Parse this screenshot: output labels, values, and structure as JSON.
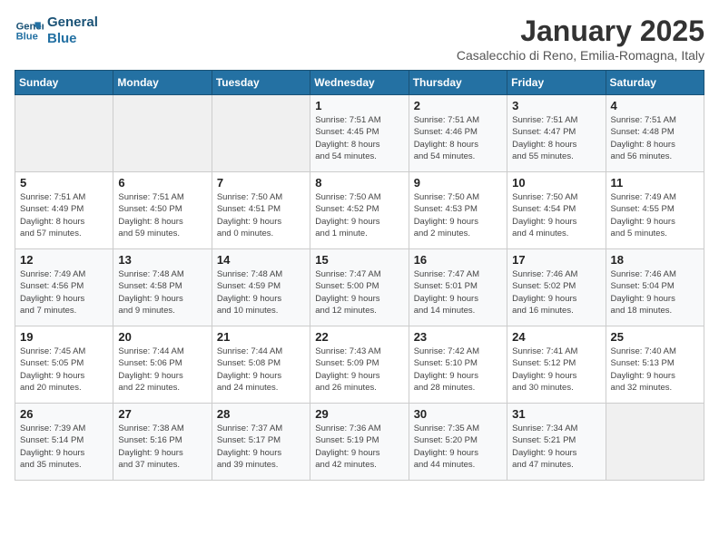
{
  "logo": {
    "line1": "General",
    "line2": "Blue"
  },
  "title": "January 2025",
  "subtitle": "Casalecchio di Reno, Emilia-Romagna, Italy",
  "weekdays": [
    "Sunday",
    "Monday",
    "Tuesday",
    "Wednesday",
    "Thursday",
    "Friday",
    "Saturday"
  ],
  "weeks": [
    [
      {
        "day": "",
        "info": ""
      },
      {
        "day": "",
        "info": ""
      },
      {
        "day": "",
        "info": ""
      },
      {
        "day": "1",
        "info": "Sunrise: 7:51 AM\nSunset: 4:45 PM\nDaylight: 8 hours\nand 54 minutes."
      },
      {
        "day": "2",
        "info": "Sunrise: 7:51 AM\nSunset: 4:46 PM\nDaylight: 8 hours\nand 54 minutes."
      },
      {
        "day": "3",
        "info": "Sunrise: 7:51 AM\nSunset: 4:47 PM\nDaylight: 8 hours\nand 55 minutes."
      },
      {
        "day": "4",
        "info": "Sunrise: 7:51 AM\nSunset: 4:48 PM\nDaylight: 8 hours\nand 56 minutes."
      }
    ],
    [
      {
        "day": "5",
        "info": "Sunrise: 7:51 AM\nSunset: 4:49 PM\nDaylight: 8 hours\nand 57 minutes."
      },
      {
        "day": "6",
        "info": "Sunrise: 7:51 AM\nSunset: 4:50 PM\nDaylight: 8 hours\nand 59 minutes."
      },
      {
        "day": "7",
        "info": "Sunrise: 7:50 AM\nSunset: 4:51 PM\nDaylight: 9 hours\nand 0 minutes."
      },
      {
        "day": "8",
        "info": "Sunrise: 7:50 AM\nSunset: 4:52 PM\nDaylight: 9 hours\nand 1 minute."
      },
      {
        "day": "9",
        "info": "Sunrise: 7:50 AM\nSunset: 4:53 PM\nDaylight: 9 hours\nand 2 minutes."
      },
      {
        "day": "10",
        "info": "Sunrise: 7:50 AM\nSunset: 4:54 PM\nDaylight: 9 hours\nand 4 minutes."
      },
      {
        "day": "11",
        "info": "Sunrise: 7:49 AM\nSunset: 4:55 PM\nDaylight: 9 hours\nand 5 minutes."
      }
    ],
    [
      {
        "day": "12",
        "info": "Sunrise: 7:49 AM\nSunset: 4:56 PM\nDaylight: 9 hours\nand 7 minutes."
      },
      {
        "day": "13",
        "info": "Sunrise: 7:48 AM\nSunset: 4:58 PM\nDaylight: 9 hours\nand 9 minutes."
      },
      {
        "day": "14",
        "info": "Sunrise: 7:48 AM\nSunset: 4:59 PM\nDaylight: 9 hours\nand 10 minutes."
      },
      {
        "day": "15",
        "info": "Sunrise: 7:47 AM\nSunset: 5:00 PM\nDaylight: 9 hours\nand 12 minutes."
      },
      {
        "day": "16",
        "info": "Sunrise: 7:47 AM\nSunset: 5:01 PM\nDaylight: 9 hours\nand 14 minutes."
      },
      {
        "day": "17",
        "info": "Sunrise: 7:46 AM\nSunset: 5:02 PM\nDaylight: 9 hours\nand 16 minutes."
      },
      {
        "day": "18",
        "info": "Sunrise: 7:46 AM\nSunset: 5:04 PM\nDaylight: 9 hours\nand 18 minutes."
      }
    ],
    [
      {
        "day": "19",
        "info": "Sunrise: 7:45 AM\nSunset: 5:05 PM\nDaylight: 9 hours\nand 20 minutes."
      },
      {
        "day": "20",
        "info": "Sunrise: 7:44 AM\nSunset: 5:06 PM\nDaylight: 9 hours\nand 22 minutes."
      },
      {
        "day": "21",
        "info": "Sunrise: 7:44 AM\nSunset: 5:08 PM\nDaylight: 9 hours\nand 24 minutes."
      },
      {
        "day": "22",
        "info": "Sunrise: 7:43 AM\nSunset: 5:09 PM\nDaylight: 9 hours\nand 26 minutes."
      },
      {
        "day": "23",
        "info": "Sunrise: 7:42 AM\nSunset: 5:10 PM\nDaylight: 9 hours\nand 28 minutes."
      },
      {
        "day": "24",
        "info": "Sunrise: 7:41 AM\nSunset: 5:12 PM\nDaylight: 9 hours\nand 30 minutes."
      },
      {
        "day": "25",
        "info": "Sunrise: 7:40 AM\nSunset: 5:13 PM\nDaylight: 9 hours\nand 32 minutes."
      }
    ],
    [
      {
        "day": "26",
        "info": "Sunrise: 7:39 AM\nSunset: 5:14 PM\nDaylight: 9 hours\nand 35 minutes."
      },
      {
        "day": "27",
        "info": "Sunrise: 7:38 AM\nSunset: 5:16 PM\nDaylight: 9 hours\nand 37 minutes."
      },
      {
        "day": "28",
        "info": "Sunrise: 7:37 AM\nSunset: 5:17 PM\nDaylight: 9 hours\nand 39 minutes."
      },
      {
        "day": "29",
        "info": "Sunrise: 7:36 AM\nSunset: 5:19 PM\nDaylight: 9 hours\nand 42 minutes."
      },
      {
        "day": "30",
        "info": "Sunrise: 7:35 AM\nSunset: 5:20 PM\nDaylight: 9 hours\nand 44 minutes."
      },
      {
        "day": "31",
        "info": "Sunrise: 7:34 AM\nSunset: 5:21 PM\nDaylight: 9 hours\nand 47 minutes."
      },
      {
        "day": "",
        "info": ""
      }
    ]
  ]
}
